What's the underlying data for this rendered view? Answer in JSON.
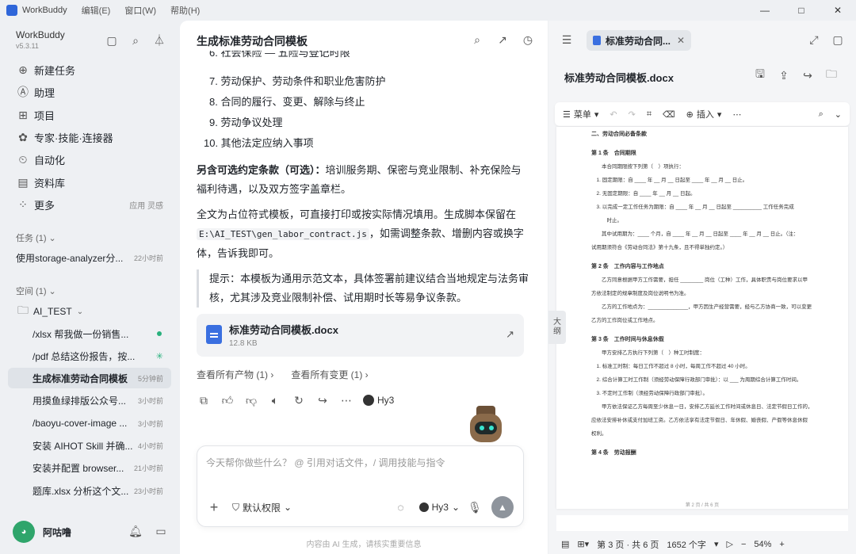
{
  "titlebar": {
    "app": "WorkBuddy",
    "menus": [
      "编辑(E)",
      "窗口(W)",
      "帮助(H)"
    ],
    "minimize": "—",
    "maximize": "□",
    "close": "✕"
  },
  "sidebar": {
    "brand": "WorkBuddy",
    "version": "v5.3.11",
    "nav": [
      {
        "label": "新建任务",
        "icon": "plus-circle-icon",
        "glyph": "⊕"
      },
      {
        "label": "助理",
        "icon": "assistant-icon",
        "glyph": "Ⓐ"
      },
      {
        "label": "项目",
        "icon": "project-icon",
        "glyph": "⊞"
      },
      {
        "label": "专家·技能·连接器",
        "icon": "expert-icon",
        "glyph": "✿"
      },
      {
        "label": "自动化",
        "icon": "automation-icon",
        "glyph": "⏲"
      },
      {
        "label": "资料库",
        "icon": "library-icon",
        "glyph": "▤"
      },
      {
        "label": "更多",
        "icon": "more-grid-icon",
        "glyph": "⁘",
        "sub": "应用 灵感"
      }
    ],
    "tasks_label": "任务 (1) ⌄",
    "tasks": [
      {
        "title": "使用storage-analyzer分...",
        "time": "22小时前"
      }
    ],
    "spaces_label": "空间 (1) ⌄",
    "folder": "AI_TEST",
    "space_tasks": [
      {
        "title": "/xlsx 帮我做一份销售...",
        "time": "",
        "status": "dot"
      },
      {
        "title": "/pdf 总结这份报告，按...",
        "time": "",
        "status": "spin"
      },
      {
        "title": "生成标准劳动合同模板",
        "time": "5分钟前",
        "status": "active"
      },
      {
        "title": "用摸鱼绿排版公众号...",
        "time": "3小时前",
        "status": ""
      },
      {
        "title": "/baoyu-cover-image ...",
        "time": "3小时前",
        "status": ""
      },
      {
        "title": "安装 AIHOT Skill 并确...",
        "time": "4小时前",
        "status": ""
      },
      {
        "title": "安装并配置 browser...",
        "time": "21小时前",
        "status": ""
      },
      {
        "title": "题库.xlsx 分析这个文...",
        "time": "23小时前",
        "status": ""
      }
    ],
    "user": {
      "name": "阿咕噜"
    }
  },
  "chat": {
    "title": "生成标准劳动合同模板",
    "cut_item": "6. 社会保险 — 五险与登记时限",
    "list": [
      "7. 劳动保护、劳动条件和职业危害防护",
      "8. 合同的履行、变更、解除与终止",
      "9. 劳动争议处理",
      "10. 其他法定应纳入事项"
    ],
    "optional_label": "另含可选约定条款（可选）：",
    "optional_text": "培训服务期、保密与竞业限制、补充保险与福利待遇，以及双方签字盖章栏。",
    "para2_a": "全文为占位符式模板，可直接打印或按实际情况填用。生成脚本保留在",
    "para2_code": "E:\\AI_TEST\\gen_labor_contract.js",
    "para2_b": "，如需调整条款、增删内容或换字体，告诉我即可。",
    "quote": "提示：本模板为通用示范文本，具体签署前建议结合当地规定与法务审核，尤其涉及竞业限制补偿、试用期时长等易争议条款。",
    "file": {
      "name": "标准劳动合同模板.docx",
      "size": "12.8 KB"
    },
    "links": [
      "查看所有产物 (1) ›",
      "查看所有变更 (1) ›"
    ],
    "model": "Hy3",
    "input_placeholder": "今天帮你做些什么？ @ 引用对话文件，/ 调用技能与指令",
    "permission": "默认权限",
    "footer": "内容由 AI 生成，请核实重要信息"
  },
  "doc": {
    "tab_title": "标准劳动合同...",
    "title": "标准劳动合同模板.docx",
    "toolbar": {
      "menu": "菜单",
      "insert": "插入"
    },
    "outline": "大纲",
    "page_lines": [
      {
        "t": "二、劳动合同必备条款",
        "h": true
      },
      {
        "t": "第 1 条　合同期限",
        "h": true
      },
      {
        "t": "　　本合同期限按下列第（　）项执行：",
        "h": false
      },
      {
        "t": "　1. 固定期限：自 ____ 年 __ 月 __ 日起至 ____ 年 __ 月 __ 日止。",
        "h": false
      },
      {
        "t": "　2. 无固定期限：自 ____ 年 __ 月 __ 日起。",
        "h": false
      },
      {
        "t": "　3. 以完成一定工作任务为期限：自 ____ 年 __ 月 __ 日起至 __________ 工作任务完成",
        "h": false
      },
      {
        "t": "　　　时止。",
        "h": false
      },
      {
        "t": "　　其中试用期为：____ 个月，自 ____ 年 __ 月 __ 日起至 ____ 年 __ 月 __ 日止。（注：",
        "h": false
      },
      {
        "t": "试用期须符合《劳动合同法》第十九条，且不得单独约定。）",
        "h": false
      },
      {
        "t": "第 2 条　工作内容与工作地点",
        "h": true
      },
      {
        "t": "　　乙方同意根据甲方工作需要，担任 ________ 岗位（工种）工作，具体职责与岗位要求以甲",
        "h": false
      },
      {
        "t": "方依法制定的规章制度及岗位说明书为准。",
        "h": false
      },
      {
        "t": "　　乙方的工作地点为：______________，甲方因生产经营需要，经与乙方协商一致，可以变更",
        "h": false
      },
      {
        "t": "乙方的工作岗位或工作地点。",
        "h": false
      },
      {
        "t": "第 3 条　工作时间与休息休假",
        "h": true
      },
      {
        "t": "　　甲方安排乙方执行下列第（　）种工时制度：",
        "h": false
      },
      {
        "t": "　1. 标准工时制：每日工作不超过 8 小时，每周工作不超过 40 小时。",
        "h": false
      },
      {
        "t": "　2. 综合计算工时工作制（须经劳动保障行政部门审批）：以 ___ 为周期综合计算工作时间。",
        "h": false
      },
      {
        "t": "　3. 不定时工作制（须经劳动保障行政部门审批）。",
        "h": false
      },
      {
        "t": "　　甲方依法保证乙方每周至少休息一日，安排乙方延长工作时间或休息日、法定节假日工作的，",
        "h": false
      },
      {
        "t": "应依法安排补休或支付加班工资。乙方依法享有法定节假日、年休假、婚丧假、产假等休息休假",
        "h": false
      },
      {
        "t": "权利。",
        "h": false
      },
      {
        "t": "第 4 条　劳动报酬",
        "h": true
      }
    ],
    "page_footer": "第 2 页 / 共 6 页",
    "status": {
      "page": "第 3 页 · 共 6 页",
      "words": "1652 个字",
      "zoom": "54%"
    }
  }
}
